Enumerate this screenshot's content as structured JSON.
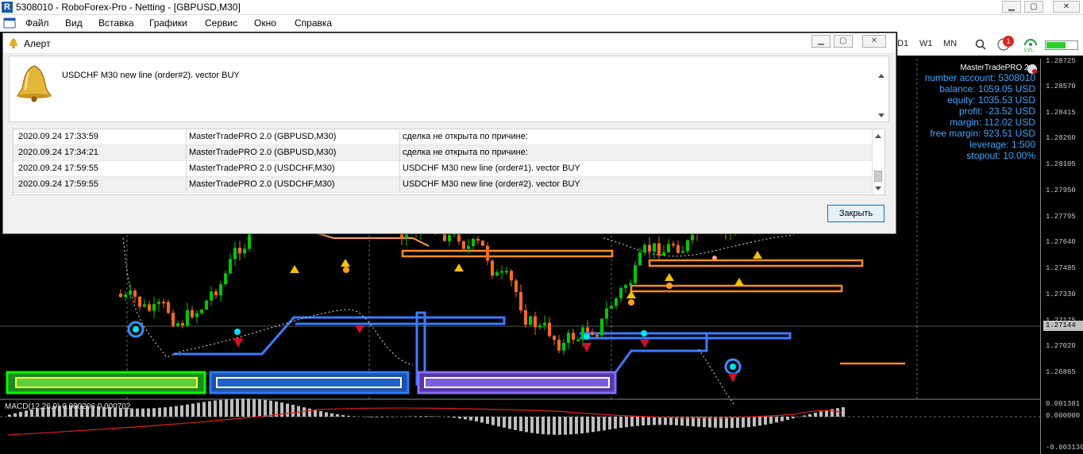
{
  "window": {
    "title": "5308010 - RoboForex-Pro - Netting - [GBPUSD,M30]",
    "app_icon": "metatrader-icon"
  },
  "menu": {
    "items": [
      "Файл",
      "Вид",
      "Вставка",
      "Графики",
      "Сервис",
      "Окно",
      "Справка"
    ]
  },
  "toolbar": {
    "timeframes": [
      "D1",
      "W1",
      "MN"
    ],
    "notification_count": "1",
    "lvl_label": "LVL"
  },
  "dialog": {
    "title": "Алерт",
    "message": "USDCHF M30 new line (order#2). vector BUY",
    "close_button": "Закрыть",
    "log": [
      {
        "time": "2020.09.24 17:33:59",
        "source": "MasterTradePRO 2.0 (GBPUSD,M30)",
        "text": "сделка не открыта по причине:"
      },
      {
        "time": "2020.09.24 17:34:21",
        "source": "MasterTradePRO 2.0 (GBPUSD,M30)",
        "text": "сделка не открыта по причине:"
      },
      {
        "time": "2020.09.24 17:59:55",
        "source": "MasterTradePRO 2.0 (USDCHF,M30)",
        "text": "USDCHF M30 new line (order#1). vector BUY"
      },
      {
        "time": "2020.09.24 17:59:55",
        "source": "MasterTradePRO 2.0 (USDCHF,M30)",
        "text": "USDCHF M30 new line (order#2). vector BUY"
      }
    ]
  },
  "info_panel": {
    "title": "MasterTradePRO 2.0",
    "lines": [
      "number account: 5308010",
      "balance: 1059.05 USD",
      "equity: 1035.53 USD",
      "profit: -23.52 USD",
      "margin: 112.02 USD",
      "free margin: 923.51 USD",
      "leverage: 1:500",
      "stopout: 10.00%"
    ]
  },
  "price_axis": {
    "labels": [
      "1.28725",
      "1.28570",
      "1.28415",
      "1.28260",
      "1.28105",
      "1.27950",
      "1.27795",
      "1.27640",
      "1.27485",
      "1.27330",
      "1.27175",
      "1.27020",
      "1.26865"
    ],
    "current_price": "1.27144"
  },
  "macd": {
    "label": "MACD(12,26,9) 0.000206 0.000702",
    "axis_labels": [
      "0.001381",
      "0.000000",
      "-0.003130"
    ]
  },
  "colors": {
    "accent_blue": "#3aa8ff",
    "bull_candle": "#00c800",
    "bear_candle": "#ff6a1a",
    "price_highlight": "#c0c0c0"
  }
}
